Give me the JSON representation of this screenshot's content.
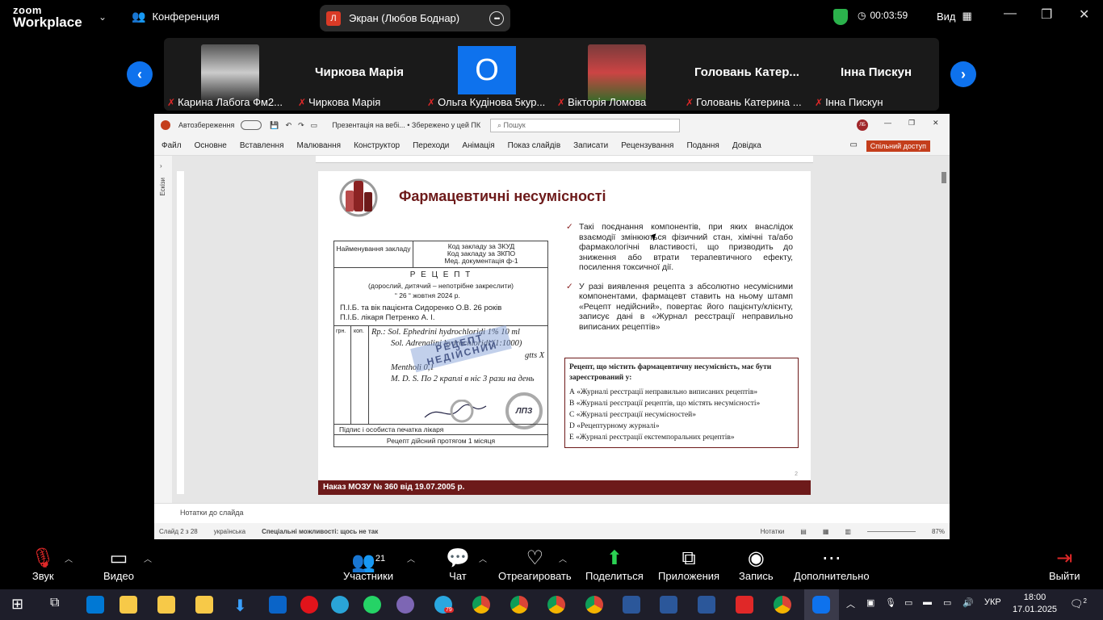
{
  "app": {
    "logo_top": "zoom",
    "logo_bottom": "Workplace",
    "meeting_title": "Конференция",
    "share_avatar": "Л",
    "share_title": "Экран (Любов Боднар)",
    "timer": "00:03:59",
    "view_label": "Вид"
  },
  "participants": [
    {
      "big": "",
      "label": "Карина Лабога Фм2..."
    },
    {
      "big": "Чиркова Марія",
      "label": "Чиркова Марія"
    },
    {
      "big": "О",
      "label": "Ольга Кудінова 5кур..."
    },
    {
      "big": "",
      "label": "Вікторія Ломова"
    },
    {
      "big": "Головань  Катер...",
      "label": "Головань Катерина ..."
    },
    {
      "big": "Інна Пискун",
      "label": "Інна Пискун"
    }
  ],
  "ppt": {
    "autosave": "Автозбереження",
    "file_title": "Презентація на вебі... • Збережено у цей ПК",
    "search": "Пошук",
    "user_initials": "ЛБ",
    "tabs": [
      "Файл",
      "Основне",
      "Вставлення",
      "Малювання",
      "Конструктор",
      "Переходи",
      "Анімація",
      "Показ слайдів",
      "Записати",
      "Рецензування",
      "Подання",
      "Довідка"
    ],
    "share_btn": "Спільний доступ",
    "thumbs_label": "Ескізи",
    "notes_placeholder": "Нотатки до слайда",
    "status": {
      "slide": "Слайд 2 з 28",
      "lang": "українська",
      "access": "Спеціальні можливості: щось не так",
      "notes": "Нотатки",
      "zoom": "87%"
    }
  },
  "slide": {
    "title": "Фармацевтичні несумісності",
    "bullets": [
      "Такі поєднання компонентів, при яких внаслідок взаємодії змінюються фізичний стан, хімічні та/або фармакологічні властивості, що призводить до зниження або втрати терапевтичного ефекту, посилення токсичної дії.",
      "У разі виявлення рецепта з абсолютно несумісними компонентами, фармацевт ставить на ньому штамп «Рецепт недійсний», повертає його пацієнту/клієнту, записує дані в «Журнал реєстрації неправильно виписаних рецептів»"
    ],
    "question": "Рецепт, що містить фармацевтичну несумісність, має бути зареєстрований у:",
    "options": [
      "А «Журналі реєстрації неправильно виписаних рецептів»",
      "В «Журналі реєстрації рецептів, що містять несумісності»",
      "С «Журналі реєстрації несумісностей»",
      "D «Рецептурному журналі»",
      "Е «Журналі реєстрації екстемпоральних рецептів»"
    ],
    "footer": "Наказ МОЗУ № 360 від 19.07.2005 р.",
    "page_num": "2",
    "rx": {
      "inst": "Найменування закладу",
      "codes": "Код закладу за ЗКУД\nКод закладу за ЗКПО\nМед. документація ф-1",
      "heading": "Р Е Ц Е П Т",
      "sub": "(дорослий, дитячий – непотрібне закреслити)",
      "date": "“ 26 “   жовтня   2024 р.",
      "patient": "П.І.Б. та вік пацієнта   Сидоренко О.В.    26 років",
      "doctor": "П.І.Б. лікаря       Петренко А. І.",
      "col1": "грн.",
      "col2": "коп.",
      "l1": "Rp.: Sol. Ephedrini hydrochloridi 1% 10 ml",
      "l2": "Sol. Adrenalini hydrochloridi (1:1000)",
      "l3": "gtts X",
      "l4": "Mentholi 0,1",
      "l5": "M. D. S. По 2 краплі в ніс 3 рази на день",
      "stamp": "РЕЦЕПТ НЕДІЙСНИЙ",
      "seal": "ЛПЗ",
      "sign": "Підпис і особиста печатка лікаря",
      "valid": "Рецепт дійсний протягом 1 місяця"
    }
  },
  "toolbar": [
    {
      "label": "Звук",
      "icon": "mic-muted-icon"
    },
    {
      "label": "Видео",
      "icon": "video-icon"
    },
    {
      "label": "Участники",
      "icon": "participants-icon",
      "count": "21"
    },
    {
      "label": "Чат",
      "icon": "chat-icon"
    },
    {
      "label": "Отреагировать",
      "icon": "heart-icon"
    },
    {
      "label": "Поделиться",
      "icon": "share-screen-icon"
    },
    {
      "label": "Приложения",
      "icon": "apps-icon"
    },
    {
      "label": "Запись",
      "icon": "record-icon"
    },
    {
      "label": "Дополнительно",
      "icon": "more-icon"
    },
    {
      "label": "Выйти",
      "icon": "leave-icon"
    }
  ],
  "taskbar": {
    "lang": "УКР",
    "time": "18:00",
    "date": "17.01.2025",
    "badge_telegram": "79",
    "notif": "2"
  }
}
